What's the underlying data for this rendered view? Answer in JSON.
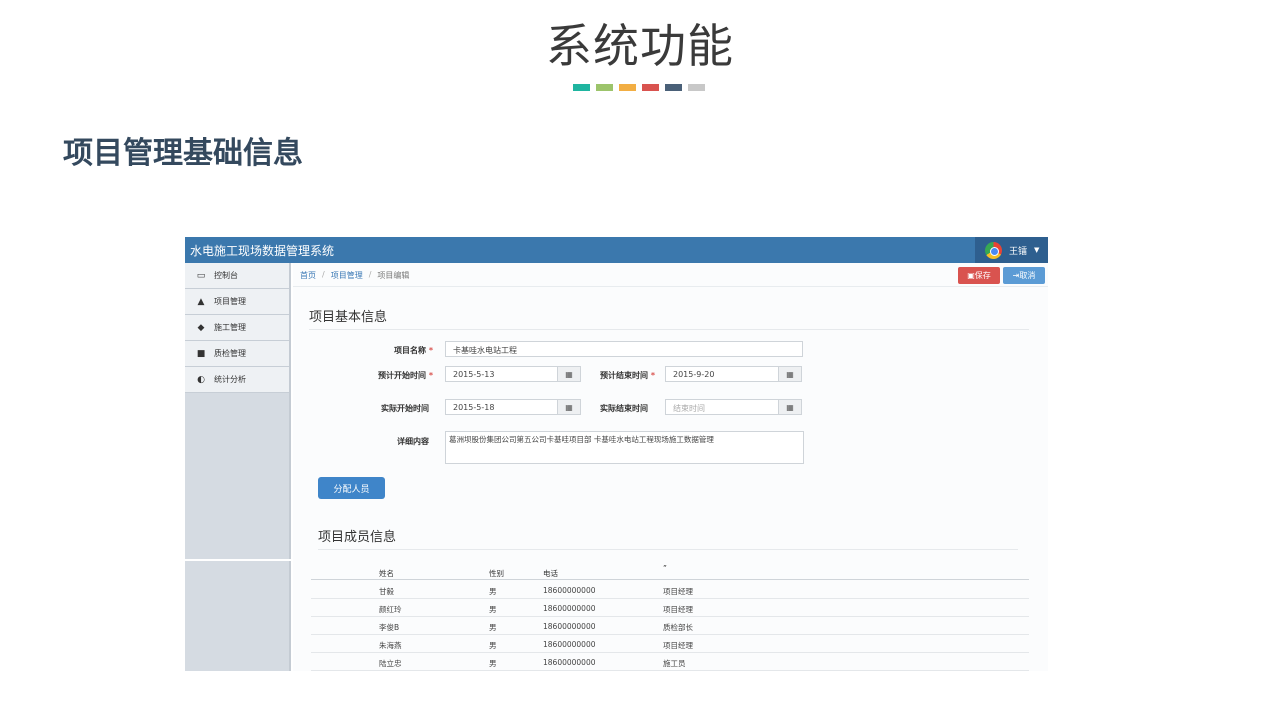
{
  "slide": {
    "title": "系统功能",
    "color_bar": [
      "#1fb5a0",
      "#9cc46b",
      "#f2ae43",
      "#d9534f",
      "#4a6078",
      "#c8c8c8"
    ],
    "section_heading": "项目管理基础信息"
  },
  "app": {
    "title": "水电施工现场数据管理系统",
    "user": {
      "name": "王镭",
      "avatar_icon": "user-avatar-icon"
    }
  },
  "sidebar": {
    "items": [
      {
        "label": "控制台",
        "icon": "laptop-icon",
        "glyph": "▭"
      },
      {
        "label": "项目管理",
        "icon": "road-icon",
        "glyph": "▲"
      },
      {
        "label": "施工管理",
        "icon": "tags-icon",
        "glyph": "◆"
      },
      {
        "label": "质检管理",
        "icon": "folder-icon",
        "glyph": "■"
      },
      {
        "label": "统计分析",
        "icon": "dashboard-icon",
        "glyph": "◐"
      }
    ]
  },
  "breadcrumb": {
    "home": "首页",
    "project": "项目管理",
    "current": "项目编辑",
    "separator": "/"
  },
  "toolbar": {
    "save_label": "保存",
    "cancel_label": "取消"
  },
  "form": {
    "section_title": "项目基本信息",
    "name_label": "项目名称",
    "name_value": "卡基哇水电站工程",
    "plan_start_label": "预计开始时间",
    "plan_start_value": "2015-5-13",
    "plan_end_label": "预计结束时间",
    "plan_end_value": "2015-9-20",
    "actual_start_label": "实际开始时间",
    "actual_start_value": "2015-5-18",
    "actual_end_label": "实际结束时间",
    "actual_end_placeholder": "结束时间",
    "detail_label": "详细内容",
    "detail_value": "葛洲坝股份集团公司第五公司卡基哇项目部 卡基哇水电站工程现场施工数据管理",
    "required_mark": "*",
    "calendar_glyph": "▦"
  },
  "assign_button": "分配人员",
  "members": {
    "title": "项目成员信息",
    "columns": [
      "姓名",
      "性别",
      "电话",
      "”"
    ],
    "rows": [
      [
        "甘毅",
        "男",
        "18600000000",
        "项目经理"
      ],
      [
        "颜红玲",
        "男",
        "18600000000",
        "项目经理"
      ],
      [
        "李俊B",
        "男",
        "18600000000",
        "质检部长"
      ],
      [
        "朱海燕",
        "男",
        "18600000000",
        "项目经理"
      ],
      [
        "陆立忠",
        "男",
        "18600000000",
        "施工员"
      ]
    ]
  }
}
